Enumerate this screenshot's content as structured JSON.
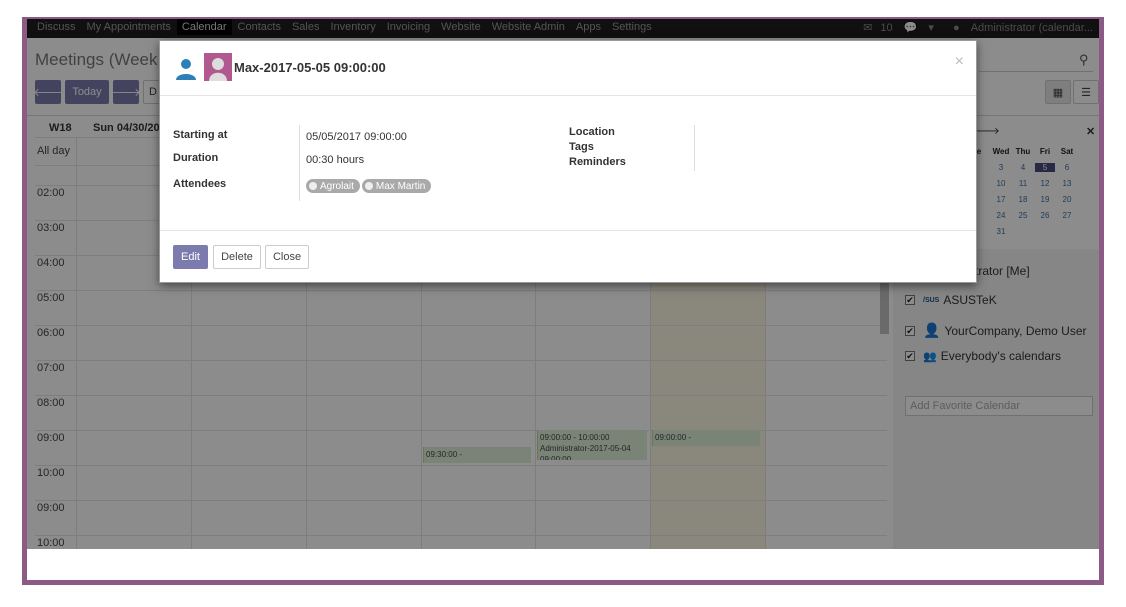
{
  "topnav": {
    "menu": [
      "Discuss",
      "My Appointments",
      "Calendar",
      "Contacts",
      "Sales",
      "Inventory",
      "Invoicing",
      "Website",
      "Website Admin",
      "Apps",
      "Settings"
    ],
    "active": "Calendar",
    "badge": "10",
    "user": "Administrator (calendar..."
  },
  "control_panel": {
    "title": "Meetings (Week 18",
    "today_label": "Today",
    "prev_icon": "arrow-left-icon",
    "next_icon": "arrow-right-icon",
    "day_label_partial": "D"
  },
  "grid": {
    "week_label": "W18",
    "first_day": "Sun 04/30/20",
    "allday_label": "All day",
    "hours": [
      "02:00",
      "03:00",
      "04:00",
      "05:00",
      "06:00",
      "07:00",
      "08:00",
      "09:00",
      "10:00",
      "09:00",
      "10:00"
    ],
    "events": [
      {
        "text": "09:30:00 -"
      },
      {
        "text": "09:00:00 - 10:00:00\nAdministrator-2017-05-04 09:00:00"
      },
      {
        "text": "09:00:00 -"
      }
    ]
  },
  "mini_calendar": {
    "headers": [
      "e",
      "Wed",
      "Thu",
      "Fri",
      "Sat"
    ],
    "rows": [
      [
        "",
        "3",
        "4",
        "5",
        "6"
      ],
      [
        "",
        "10",
        "11",
        "12",
        "13"
      ],
      [
        "",
        "17",
        "18",
        "19",
        "20"
      ],
      [
        "",
        "24",
        "25",
        "26",
        "27"
      ],
      [
        "",
        "31",
        "",
        "",
        ""
      ]
    ],
    "selected": "5"
  },
  "filters": {
    "me": "strator [Me]",
    "items": [
      "ASUSTeK",
      "YourCompany, Demo User",
      "Everybody's calendars"
    ],
    "add_placeholder": "Add Favorite Calendar"
  },
  "modal": {
    "title": "Max-2017-05-05 09:00:00",
    "fields": {
      "starting_at_label": "Starting at",
      "starting_at_value": "05/05/2017 09:00:00",
      "duration_label": "Duration",
      "duration_value": "00:30 hours",
      "attendees_label": "Attendees",
      "attendees": [
        "Agrolait",
        "Max Martin"
      ],
      "location_label": "Location",
      "tags_label": "Tags",
      "reminders_label": "Reminders"
    },
    "buttons": {
      "edit": "Edit",
      "delete": "Delete",
      "close": "Close"
    },
    "close_icon": "close-icon"
  },
  "colors": {
    "frame": "#8b5b86",
    "primary": "#7c7bad",
    "today": "#fcf8e3",
    "event": "#dff0d8"
  }
}
